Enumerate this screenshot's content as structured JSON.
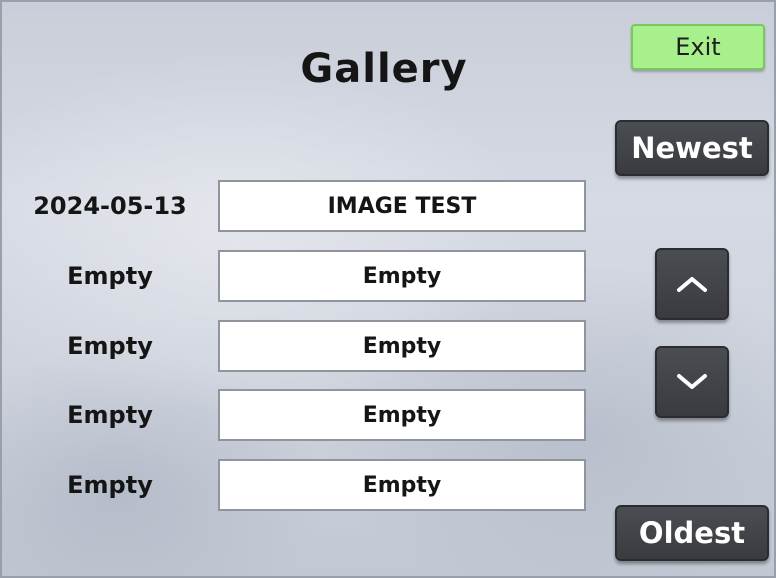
{
  "gallery": {
    "title": "Gallery",
    "exit_label": "Exit",
    "newest_label": "Newest",
    "oldest_label": "Oldest",
    "scroll_up_icon": "chevron-up-icon",
    "scroll_down_icon": "chevron-down-icon",
    "entries": [
      {
        "date": "2024-05-13",
        "name": "IMAGE TEST"
      },
      {
        "date": "Empty",
        "name": "Empty"
      },
      {
        "date": "Empty",
        "name": "Empty"
      },
      {
        "date": "Empty",
        "name": "Empty"
      },
      {
        "date": "Empty",
        "name": "Empty"
      }
    ]
  },
  "colors": {
    "exit_button": "#a8f08c",
    "dark_button": "#3f4246",
    "slot_background": "#ffffff"
  }
}
